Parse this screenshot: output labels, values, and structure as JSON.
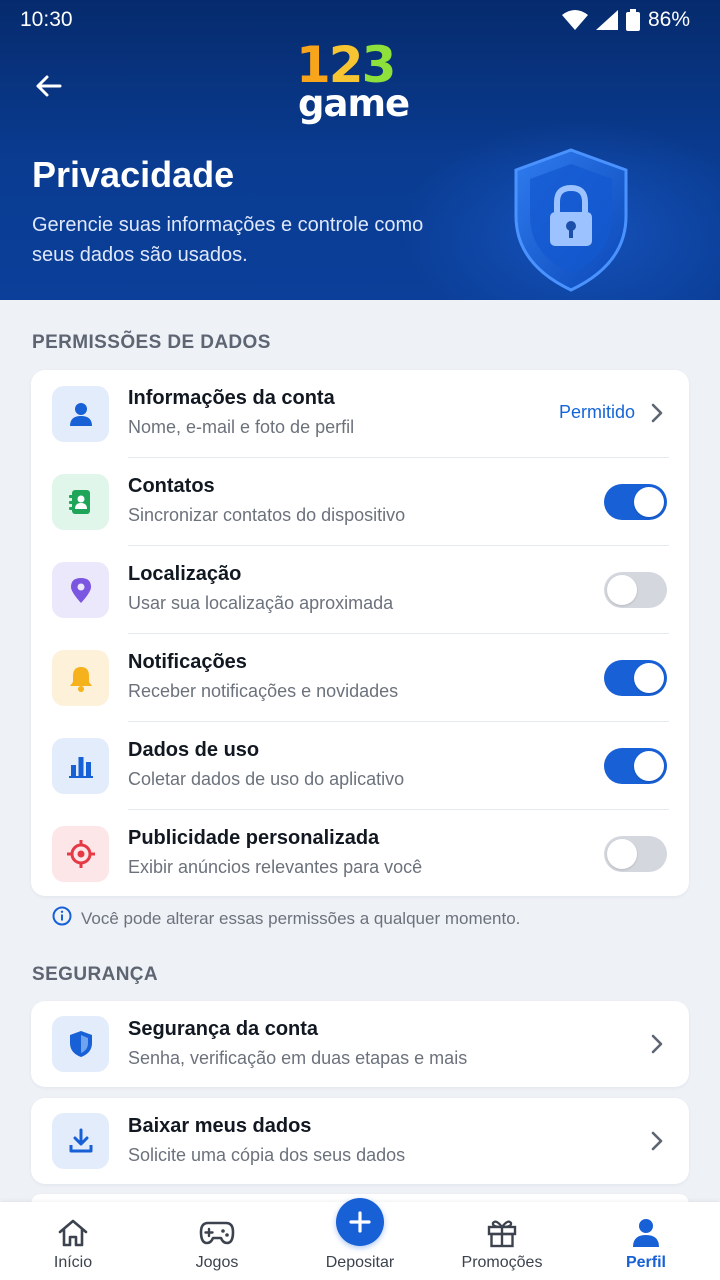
{
  "status_bar": {
    "time": "10:30",
    "battery": "86%"
  },
  "header": {
    "logo_numbers": [
      "1",
      "2",
      "3"
    ],
    "logo_word": "game",
    "title": "Privacidade",
    "subtitle": "Gerencie suas informações e controle como seus dados são usados."
  },
  "permissions": {
    "section_label": "PERMISSÕES DE DADOS",
    "items": [
      {
        "title": "Informações da conta",
        "subtitle": "Nome, e-mail e foto de perfil",
        "status": "Permitido",
        "icon": "person-icon"
      },
      {
        "title": "Contatos",
        "subtitle": "Sincronizar contatos do dispositivo",
        "enabled": true,
        "icon": "contacts-book-icon"
      },
      {
        "title": "Localização",
        "subtitle": "Usar sua localização aproximada",
        "enabled": false,
        "icon": "location-pin-icon"
      },
      {
        "title": "Notificações",
        "subtitle": "Receber notificações e novidades",
        "enabled": true,
        "icon": "bell-icon"
      },
      {
        "title": "Dados de uso",
        "subtitle": "Coletar dados de uso do aplicativo",
        "enabled": true,
        "icon": "bar-chart-icon"
      },
      {
        "title": "Publicidade personalizada",
        "subtitle": "Exibir anúncios relevantes para você",
        "enabled": false,
        "icon": "target-icon"
      }
    ],
    "note": "Você pode alterar essas permissões a qualquer momento."
  },
  "security": {
    "section_label": "SEGURANÇA",
    "items": [
      {
        "title": "Segurança da conta",
        "subtitle": "Senha, verificação em duas etapas e mais",
        "icon": "shield-icon"
      },
      {
        "title": "Baixar meus dados",
        "subtitle": "Solicite uma cópia dos seus dados",
        "icon": "download-icon"
      }
    ]
  },
  "bottom_nav": {
    "items": [
      {
        "label": "Início",
        "icon": "home-icon",
        "active": false
      },
      {
        "label": "Jogos",
        "icon": "gamepad-icon",
        "active": false
      },
      {
        "label": "Depositar",
        "icon": "plus-icon",
        "active": false
      },
      {
        "label": "Promoções",
        "icon": "gift-icon",
        "active": false
      },
      {
        "label": "Perfil",
        "icon": "profile-icon",
        "active": true
      }
    ]
  },
  "colors": {
    "header_dark": "#062b6d",
    "accent": "#1760d6",
    "toggle_off": "#d4d7dd",
    "logo_orange": "#f8a51b",
    "logo_yellow": "#f6c531",
    "logo_green": "#8ee13a"
  }
}
